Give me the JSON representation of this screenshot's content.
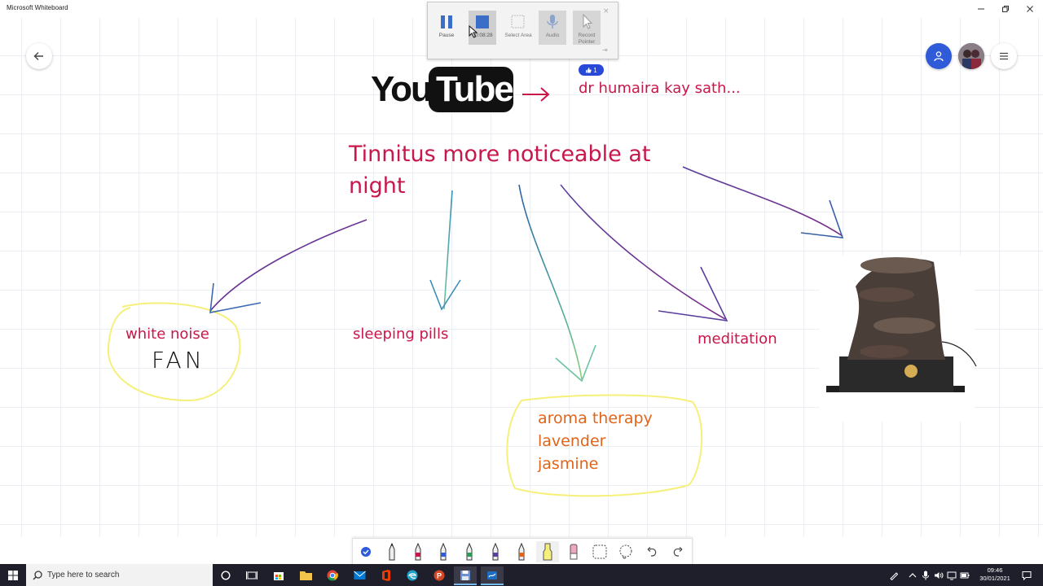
{
  "window": {
    "title": "Microsoft Whiteboard"
  },
  "recorder": {
    "pause_label": "Pause",
    "timer": "00:08:28",
    "select_area_label": "Select Area",
    "audio_label": "Audio",
    "record_pointer_label": "Record Pointer"
  },
  "board": {
    "youtube_you": "You",
    "youtube_tube": "Tube",
    "reaction_count": "1",
    "channel_note": "dr humaira kay sath...",
    "main_line1": "Tinnitus more noticeable at",
    "main_line2": "night",
    "white_noise": "white noise",
    "fan": "FAN",
    "sleeping_pills": "sleeping pills",
    "meditation": "meditation",
    "aroma_line1": "aroma therapy",
    "aroma_line2": "lavender",
    "aroma_line3": "jasmine"
  },
  "taskbar": {
    "search_placeholder": "Type here to search",
    "time": "09:46",
    "date": "30/01/2021"
  },
  "colors": {
    "crimson": "#c8174a",
    "orange": "#e0641a",
    "highlight_yellow": "#f5f07a",
    "accent_blue": "#2f5bd9",
    "taskbar": "#1f1f2b"
  }
}
